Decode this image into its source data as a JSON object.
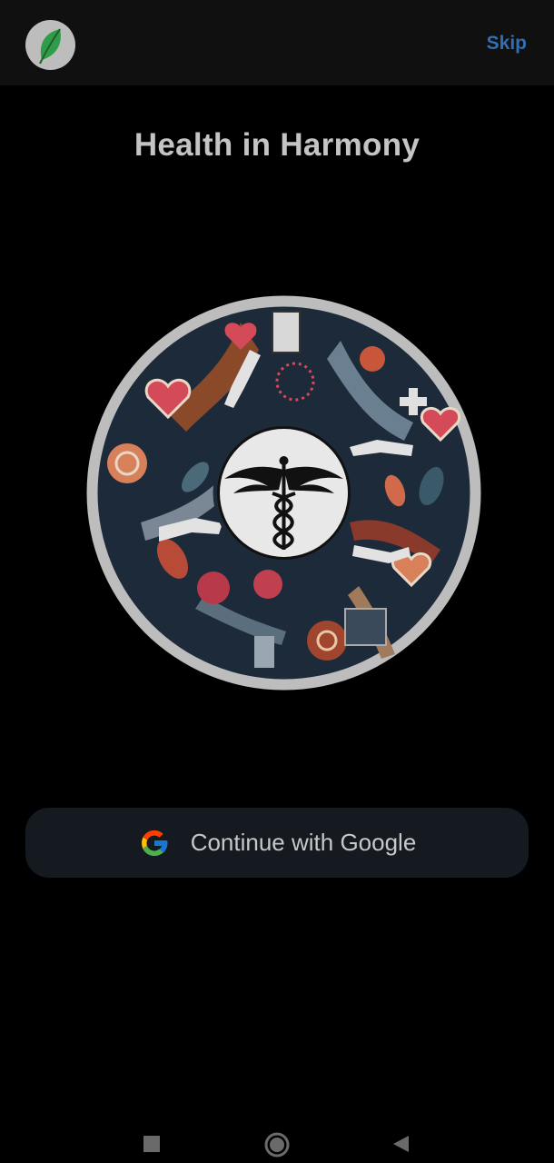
{
  "header": {
    "logo_icon": "leaf-icon",
    "skip_label": "Skip"
  },
  "main": {
    "title": "Health in Harmony",
    "hero_icon": "caduceus-icon"
  },
  "auth": {
    "google_button_label": "Continue with Google",
    "google_icon": "google-g-icon"
  },
  "system_nav": {
    "recents_icon": "square-icon",
    "home_icon": "circle-icon",
    "back_icon": "triangle-back-icon"
  },
  "colors": {
    "background": "#000000",
    "topbar": "#101010",
    "skip_accent": "#2f6fb3",
    "button_bg": "#141a20"
  }
}
